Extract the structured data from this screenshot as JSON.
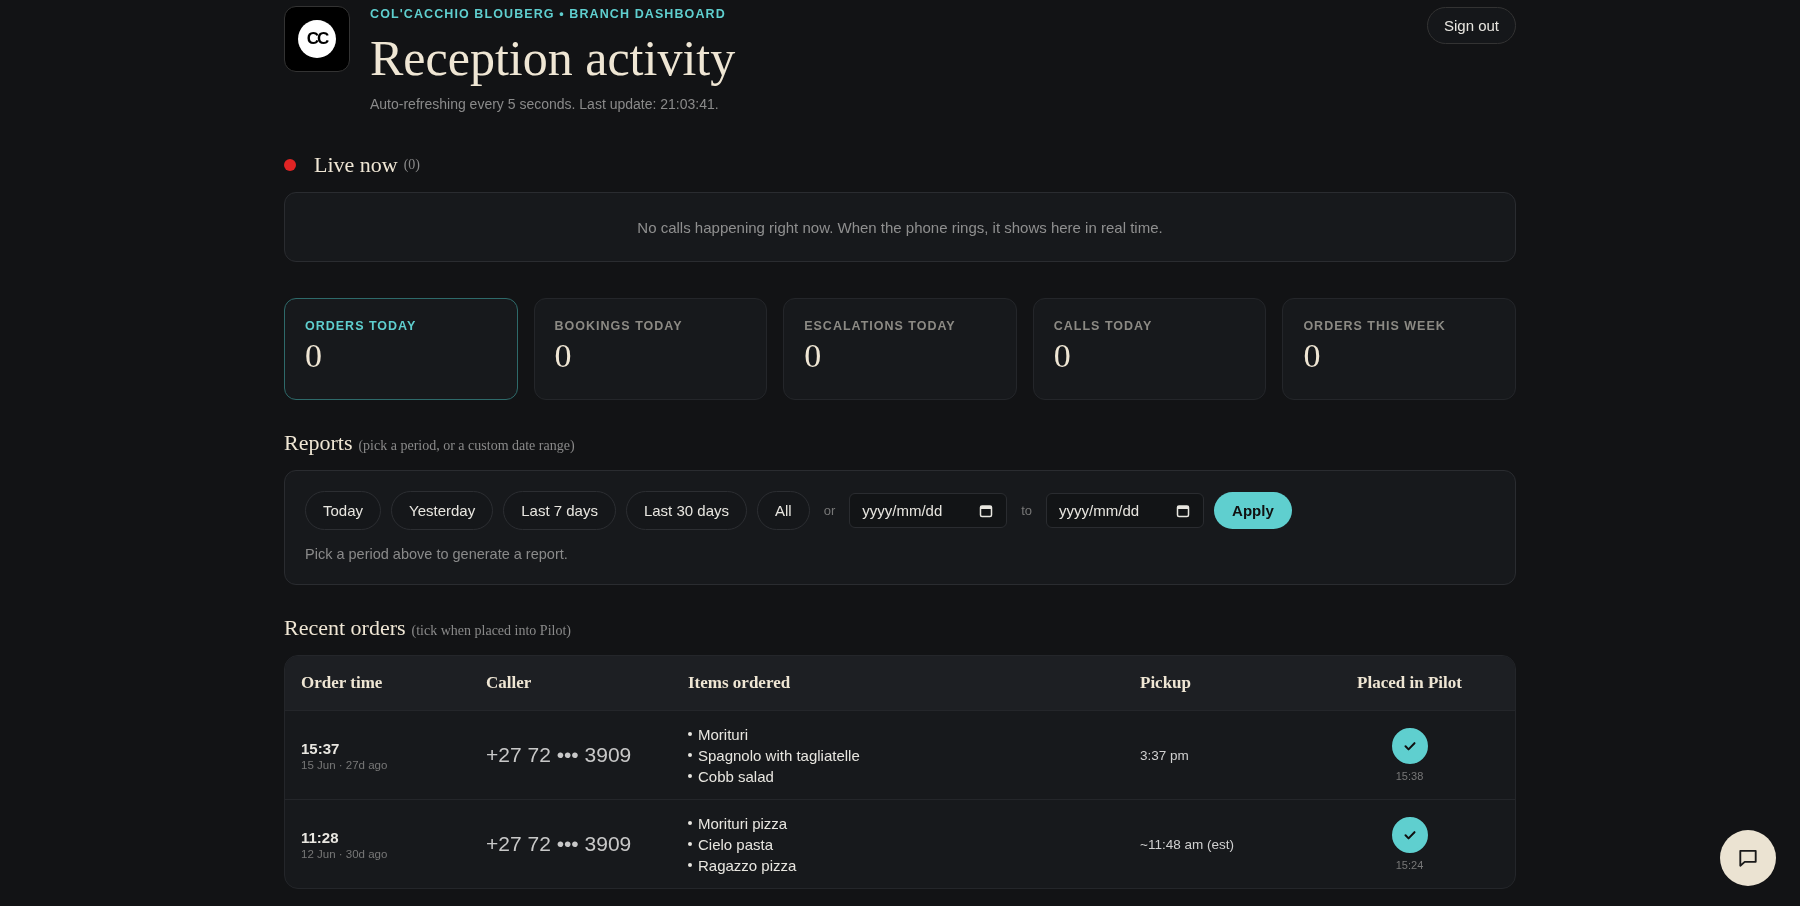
{
  "header": {
    "logo": "CC",
    "eyebrow": "COL'CACCHIO BLOUBERG • BRANCH DASHBOARD",
    "title": "Reception activity",
    "subtitle": "Auto-refreshing every 5 seconds. Last update: 21:03:41.",
    "sign_out": "Sign out"
  },
  "live": {
    "title": "Live now",
    "count": "(0)",
    "empty_message": "No calls happening right now. When the phone rings, it shows here in real time."
  },
  "stats": [
    {
      "label": "ORDERS TODAY",
      "value": "0",
      "selected": true
    },
    {
      "label": "BOOKINGS TODAY",
      "value": "0",
      "selected": false
    },
    {
      "label": "ESCALATIONS TODAY",
      "value": "0",
      "selected": false
    },
    {
      "label": "CALLS TODAY",
      "value": "0",
      "selected": false
    },
    {
      "label": "ORDERS THIS WEEK",
      "value": "0",
      "selected": false
    }
  ],
  "reports": {
    "title": "Reports",
    "hint": "(pick a period, or a custom date range)",
    "periods": [
      {
        "label": "Today",
        "selected": false
      },
      {
        "label": "Yesterday",
        "selected": false
      },
      {
        "label": "Last 7 days",
        "selected": false
      },
      {
        "label": "Last 30 days",
        "selected": false
      },
      {
        "label": "All",
        "selected": false
      }
    ],
    "or": "or",
    "from": {
      "placeholder": "yyyy/mm/dd"
    },
    "to_label": "to",
    "to": {
      "placeholder": "yyyy/mm/dd"
    },
    "apply": "Apply",
    "message": "Pick a period above to generate a report."
  },
  "orders": {
    "title": "Recent orders",
    "hint": "(tick when placed into Pilot)",
    "columns": [
      "Order time",
      "Caller",
      "Items ordered",
      "Pickup",
      "Placed in Pilot"
    ],
    "rows": [
      {
        "time": "15:37",
        "date": "15 Jun · 27d ago",
        "caller": "+27 72 ••• 3909",
        "items": [
          "Morituri",
          "Spagnolo with tagliatelle",
          "Cobb salad"
        ],
        "pickup": "3:37 pm",
        "placed": true,
        "placed_time": "15:38"
      },
      {
        "time": "11:28",
        "date": "12 Jun · 30d ago",
        "caller": "+27 72 ••• 3909",
        "items": [
          "Morituri pizza",
          "Cielo pasta",
          "Ragazzo pizza"
        ],
        "pickup": "~11:48 am (est)",
        "placed": true,
        "placed_time": "15:24"
      }
    ]
  }
}
